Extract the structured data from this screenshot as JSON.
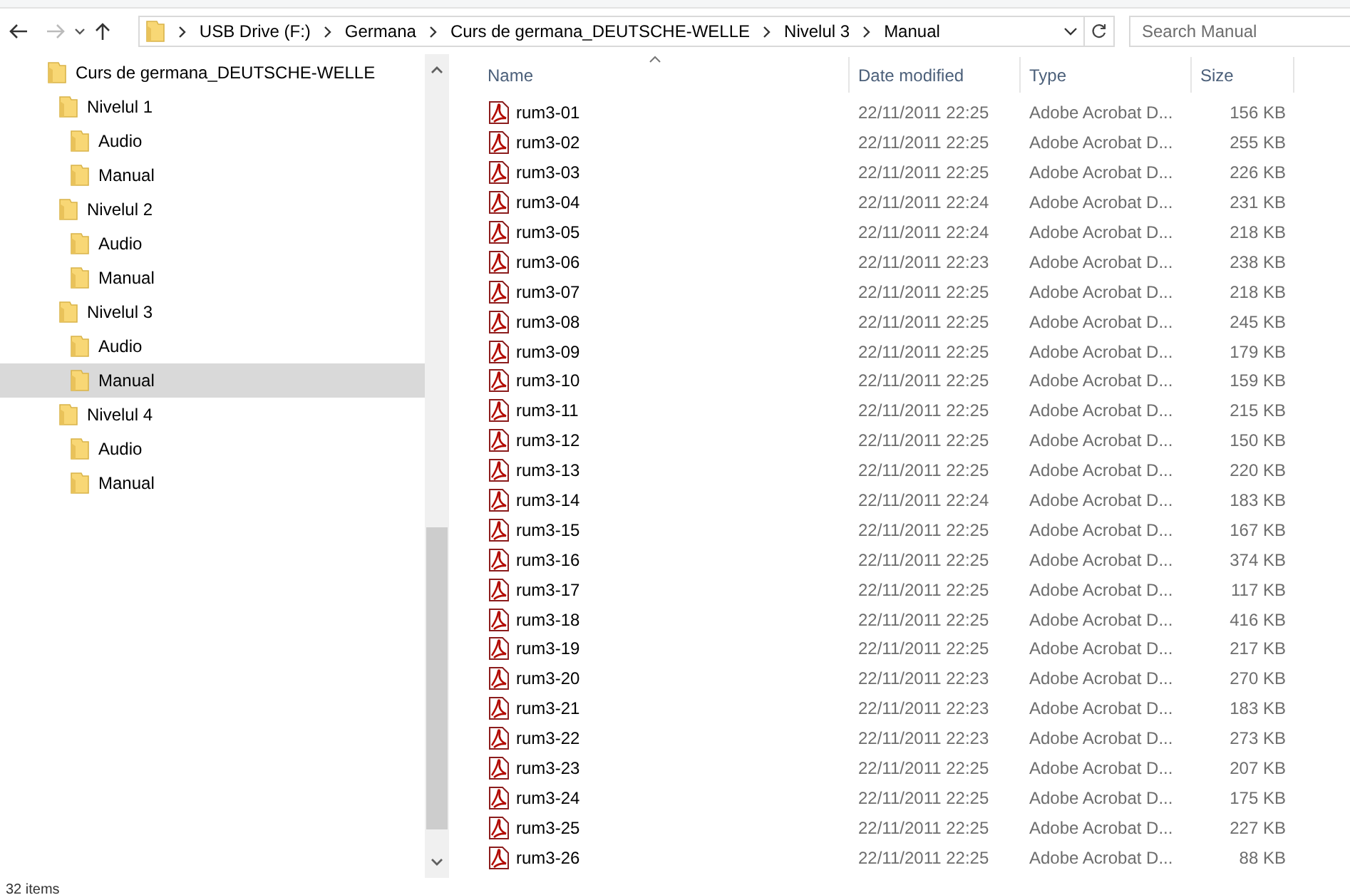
{
  "address_bar": {
    "path": [
      "USB Drive (F:)",
      "Germana",
      "Curs de germana_DEUTSCHE-WELLE",
      "Nivelul 3",
      "Manual"
    ]
  },
  "search": {
    "placeholder": "Search Manual"
  },
  "navigation_pane": {
    "items": [
      {
        "label": "Curs de germana_DEUTSCHE-WELLE",
        "selected": false,
        "children": [
          {
            "label": "Nivelul 1",
            "selected": false,
            "children": [
              {
                "label": "Audio",
                "selected": false
              },
              {
                "label": "Manual",
                "selected": false
              }
            ]
          },
          {
            "label": "Nivelul 2",
            "selected": false,
            "children": [
              {
                "label": "Audio",
                "selected": false
              },
              {
                "label": "Manual",
                "selected": false
              }
            ]
          },
          {
            "label": "Nivelul 3",
            "selected": false,
            "children": [
              {
                "label": "Audio",
                "selected": false
              },
              {
                "label": "Manual",
                "selected": true
              }
            ]
          },
          {
            "label": "Nivelul 4",
            "selected": false,
            "children": [
              {
                "label": "Audio",
                "selected": false
              },
              {
                "label": "Manual",
                "selected": false
              }
            ]
          }
        ]
      }
    ]
  },
  "file_list": {
    "columns": [
      {
        "label": "Name",
        "sorted": true
      },
      {
        "label": "Date modified",
        "sorted": false
      },
      {
        "label": "Type",
        "sorted": false
      },
      {
        "label": "Size",
        "sorted": false
      }
    ],
    "rows": [
      {
        "name": "rum3-01",
        "date_modified": "22/11/2011 22:25",
        "type": "Adobe Acrobat D...",
        "size": "156 KB"
      },
      {
        "name": "rum3-02",
        "date_modified": "22/11/2011 22:25",
        "type": "Adobe Acrobat D...",
        "size": "255 KB"
      },
      {
        "name": "rum3-03",
        "date_modified": "22/11/2011 22:25",
        "type": "Adobe Acrobat D...",
        "size": "226 KB"
      },
      {
        "name": "rum3-04",
        "date_modified": "22/11/2011 22:24",
        "type": "Adobe Acrobat D...",
        "size": "231 KB"
      },
      {
        "name": "rum3-05",
        "date_modified": "22/11/2011 22:24",
        "type": "Adobe Acrobat D...",
        "size": "218 KB"
      },
      {
        "name": "rum3-06",
        "date_modified": "22/11/2011 22:23",
        "type": "Adobe Acrobat D...",
        "size": "238 KB"
      },
      {
        "name": "rum3-07",
        "date_modified": "22/11/2011 22:25",
        "type": "Adobe Acrobat D...",
        "size": "218 KB"
      },
      {
        "name": "rum3-08",
        "date_modified": "22/11/2011 22:25",
        "type": "Adobe Acrobat D...",
        "size": "245 KB"
      },
      {
        "name": "rum3-09",
        "date_modified": "22/11/2011 22:25",
        "type": "Adobe Acrobat D...",
        "size": "179 KB"
      },
      {
        "name": "rum3-10",
        "date_modified": "22/11/2011 22:25",
        "type": "Adobe Acrobat D...",
        "size": "159 KB"
      },
      {
        "name": "rum3-11",
        "date_modified": "22/11/2011 22:25",
        "type": "Adobe Acrobat D...",
        "size": "215 KB"
      },
      {
        "name": "rum3-12",
        "date_modified": "22/11/2011 22:25",
        "type": "Adobe Acrobat D...",
        "size": "150 KB"
      },
      {
        "name": "rum3-13",
        "date_modified": "22/11/2011 22:25",
        "type": "Adobe Acrobat D...",
        "size": "220 KB"
      },
      {
        "name": "rum3-14",
        "date_modified": "22/11/2011 22:24",
        "type": "Adobe Acrobat D...",
        "size": "183 KB"
      },
      {
        "name": "rum3-15",
        "date_modified": "22/11/2011 22:25",
        "type": "Adobe Acrobat D...",
        "size": "167 KB"
      },
      {
        "name": "rum3-16",
        "date_modified": "22/11/2011 22:25",
        "type": "Adobe Acrobat D...",
        "size": "374 KB"
      },
      {
        "name": "rum3-17",
        "date_modified": "22/11/2011 22:25",
        "type": "Adobe Acrobat D...",
        "size": "117 KB"
      },
      {
        "name": "rum3-18",
        "date_modified": "22/11/2011 22:25",
        "type": "Adobe Acrobat D...",
        "size": "416 KB"
      },
      {
        "name": "rum3-19",
        "date_modified": "22/11/2011 22:25",
        "type": "Adobe Acrobat D...",
        "size": "217 KB"
      },
      {
        "name": "rum3-20",
        "date_modified": "22/11/2011 22:23",
        "type": "Adobe Acrobat D...",
        "size": "270 KB"
      },
      {
        "name": "rum3-21",
        "date_modified": "22/11/2011 22:23",
        "type": "Adobe Acrobat D...",
        "size": "183 KB"
      },
      {
        "name": "rum3-22",
        "date_modified": "22/11/2011 22:23",
        "type": "Adobe Acrobat D...",
        "size": "273 KB"
      },
      {
        "name": "rum3-23",
        "date_modified": "22/11/2011 22:25",
        "type": "Adobe Acrobat D...",
        "size": "207 KB"
      },
      {
        "name": "rum3-24",
        "date_modified": "22/11/2011 22:25",
        "type": "Adobe Acrobat D...",
        "size": "175 KB"
      },
      {
        "name": "rum3-25",
        "date_modified": "22/11/2011 22:25",
        "type": "Adobe Acrobat D...",
        "size": "227 KB"
      },
      {
        "name": "rum3-26",
        "date_modified": "22/11/2011 22:25",
        "type": "Adobe Acrobat D...",
        "size": "88 KB"
      }
    ]
  },
  "status_bar": {
    "item_count": "32 items"
  }
}
